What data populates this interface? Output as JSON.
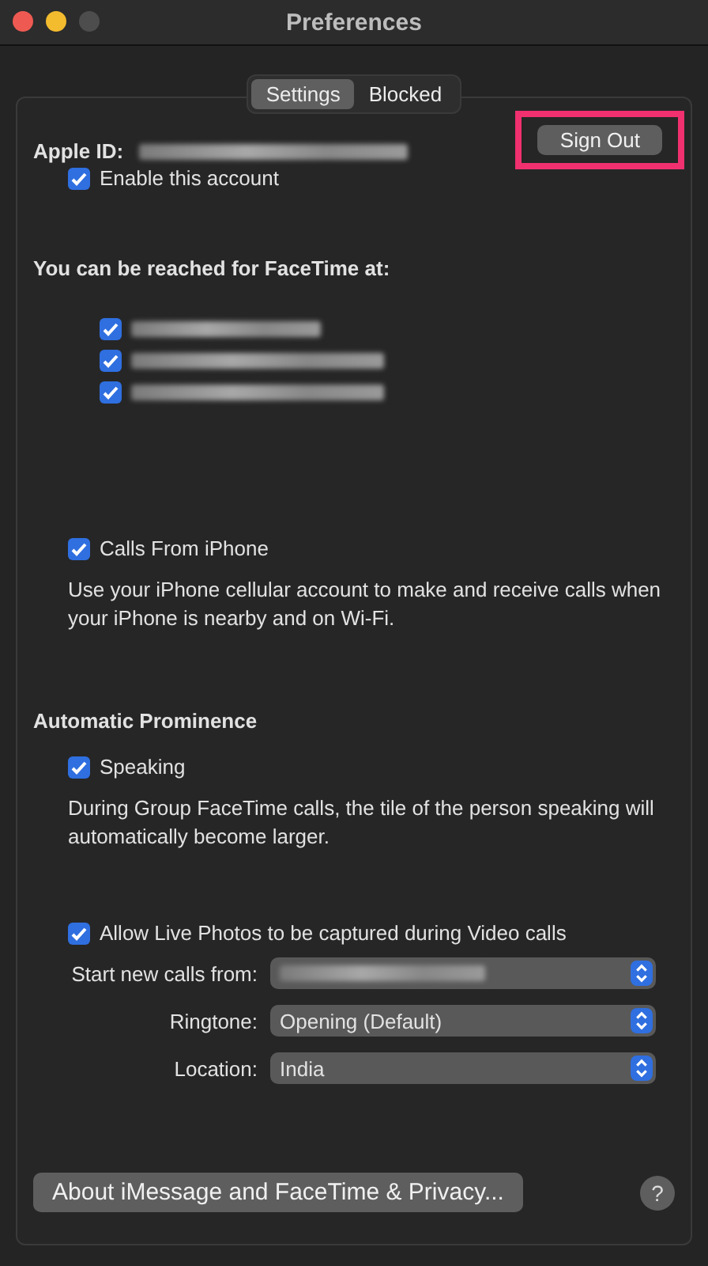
{
  "window": {
    "title": "Preferences"
  },
  "tabs": [
    {
      "label": "Settings",
      "selected": true
    },
    {
      "label": "Blocked",
      "selected": false
    }
  ],
  "apple_id": {
    "label": "Apple ID:",
    "redacted": true
  },
  "sign_out": {
    "label": "Sign Out",
    "highlighted": true
  },
  "enable_account": {
    "label": "Enable this account",
    "checked": true
  },
  "reach_heading": "You can be reached for FaceTime at:",
  "addresses": [
    {
      "checked": true,
      "redacted": true
    },
    {
      "checked": true,
      "redacted": true
    },
    {
      "checked": true,
      "redacted": true
    }
  ],
  "calls_from_iphone": {
    "label": "Calls From iPhone",
    "checked": true,
    "description": "Use your iPhone cellular account to make and receive calls when your iPhone is nearby and on Wi-Fi."
  },
  "prominence_heading": "Automatic Prominence",
  "speaking": {
    "label": "Speaking",
    "checked": true,
    "description": "During Group FaceTime calls, the tile of the person speaking will automatically become larger."
  },
  "live_photos": {
    "label": "Allow Live Photos to be captured during Video calls",
    "checked": true
  },
  "popups": [
    {
      "label": "Start new calls from:",
      "redacted": true
    },
    {
      "label": "Ringtone:",
      "value": "Opening (Default)"
    },
    {
      "label": "Location:",
      "value": "India"
    }
  ],
  "about_button": "About iMessage and FaceTime & Privacy...",
  "help_button": "?"
}
